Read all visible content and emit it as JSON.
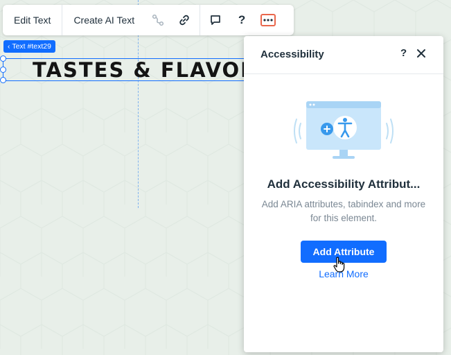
{
  "toolbar": {
    "edit_text_label": "Edit Text",
    "create_ai_text_label": "Create AI Text",
    "icons": [
      "animation-path-icon",
      "link-icon",
      "comment-icon",
      "help-icon",
      "more-icon"
    ],
    "help_label": "?"
  },
  "element": {
    "tag_label": "Text #text29",
    "text": "TASTES & FLAVORS"
  },
  "panel": {
    "title": "Accessibility",
    "help_label": "?",
    "heading": "Add Accessibility Attribut...",
    "description": "Add ARIA attributes, tabindex and more for this element.",
    "add_button_label": "Add Attribute",
    "learn_more_label": "Learn More"
  },
  "colors": {
    "accent": "#116dff",
    "highlight_border": "#e9664b",
    "canvas_bg": "#e8efe9"
  }
}
